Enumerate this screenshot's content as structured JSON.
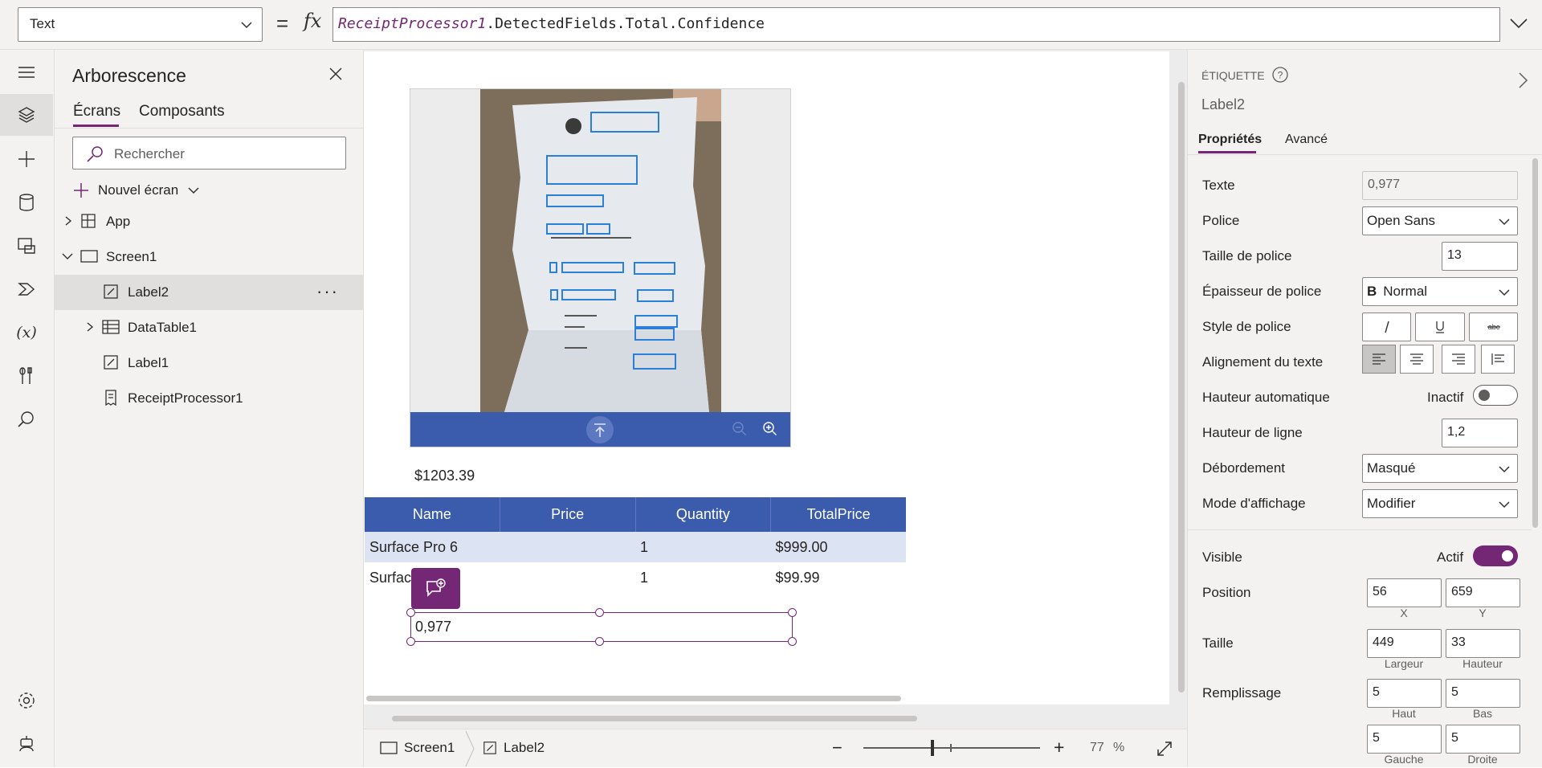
{
  "formula_bar": {
    "property": "Text",
    "equals": "=",
    "fx": "fx",
    "formula_control": "ReceiptProcessor1",
    "formula_rest": ".DetectedFields.Total.Confidence"
  },
  "tree": {
    "title": "Arborescence",
    "tabs": [
      "Écrans",
      "Composants"
    ],
    "search_placeholder": "Rechercher",
    "new_screen": "Nouvel écran",
    "items": [
      {
        "label": "App"
      },
      {
        "label": "Screen1"
      },
      {
        "label": "Label2"
      },
      {
        "label": "DataTable1"
      },
      {
        "label": "Label1"
      },
      {
        "label": "ReceiptProcessor1"
      }
    ],
    "more": "···"
  },
  "canvas": {
    "total_value": "$1203.39",
    "table": {
      "headers": [
        "Name",
        "Price",
        "Quantity",
        "TotalPrice"
      ],
      "rows": [
        [
          "Surface Pro 6",
          "",
          "1",
          "$999.00"
        ],
        [
          "Surfac",
          "",
          "1",
          "$99.99"
        ]
      ]
    },
    "label2_value": "0,977"
  },
  "bottom": {
    "screen": "Screen1",
    "control": "Label2",
    "minus": "−",
    "plus": "+",
    "zoom": "77",
    "pct": "%"
  },
  "props": {
    "section": "ÉTIQUETTE",
    "control_name": "Label2",
    "tabs": [
      "Propriétés",
      "Avancé"
    ],
    "texte_label": "Texte",
    "texte_value": "0,977",
    "police_label": "Police",
    "police_value": "Open Sans",
    "taille_label": "Taille de police",
    "taille_value": "13",
    "epaisseur_label": "Épaisseur de police",
    "epaisseur_value": "Normal",
    "epaisseur_icon": "B",
    "style_label": "Style de police",
    "align_label": "Alignement du texte",
    "hauteur_auto_label": "Hauteur automatique",
    "hauteur_auto_state": "Inactif",
    "hauteur_ligne_label": "Hauteur de ligne",
    "hauteur_ligne_value": "1,2",
    "debordement_label": "Débordement",
    "debordement_value": "Masqué",
    "mode_label": "Mode d'affichage",
    "mode_value": "Modifier",
    "visible_label": "Visible",
    "visible_state": "Actif",
    "position_label": "Position",
    "pos_x": "56",
    "pos_y": "659",
    "x_sub": "X",
    "y_sub": "Y",
    "taille2_label": "Taille",
    "largeur": "449",
    "hauteur": "33",
    "largeur_sub": "Largeur",
    "hauteur_sub": "Hauteur",
    "remplissage_label": "Remplissage",
    "haut": "5",
    "bas": "5",
    "gauche": "5",
    "droite": "5",
    "haut_sub": "Haut",
    "bas_sub": "Bas",
    "gauche_sub": "Gauche",
    "droite_sub": "Droite"
  },
  "colors": {
    "accent": "#742774",
    "table_header": "#3b5cad",
    "panel": "#f3f2f1"
  }
}
